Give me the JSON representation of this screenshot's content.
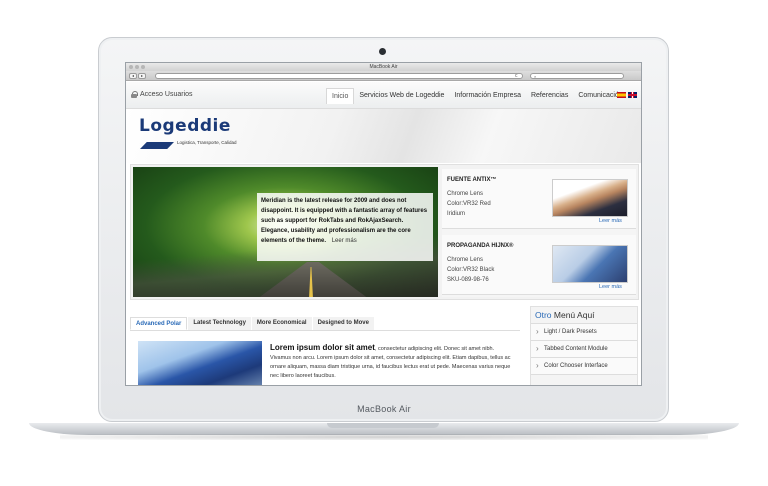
{
  "device": {
    "brand": "MacBook Air"
  },
  "browser": {
    "window_title": "MacBook Air",
    "back_glyph": "◂",
    "forward_glyph": "▸",
    "reload_glyph": "c",
    "url_placeholder": "",
    "search_placeholder": ""
  },
  "nav": {
    "user_access": "Acceso Usuarios",
    "items": [
      {
        "label": "Inicio",
        "active": true
      },
      {
        "label": "Servicios Web de Logeddie"
      },
      {
        "label": "Información Empresa"
      },
      {
        "label": "Referencias"
      },
      {
        "label": "Comunicación"
      }
    ],
    "flags": [
      "es-flag-icon",
      "uk-flag-icon"
    ]
  },
  "header": {
    "logo": "Logeddie",
    "tagline": "Logistica, Transporte, Calidad"
  },
  "slideshow": {
    "caption": "Meridian is the latest release for 2009 and does not disappoint. It is equipped with a fantastic array of features such as support for RokTabs and RokAjaxSearch. Elegance, usability and professionalism are the core elements of the theme.",
    "more": "Leer más"
  },
  "products": [
    {
      "title": "FUENTE ANTIX™",
      "lines": [
        "Chrome Lens",
        "Color:VR32 Red",
        "Iridium"
      ],
      "more": "Leer más",
      "image": "handshake-image"
    },
    {
      "title": "PROPAGANDA HIJNX®",
      "lines": [
        "Chrome Lens",
        "Color:VR32 Black",
        "SKU-089-98-76"
      ],
      "more": "Leer más",
      "image": "calculator-image"
    }
  ],
  "tabs": [
    "Advanced Polar",
    "Latest Technology",
    "More Economical",
    "Designed to Move"
  ],
  "article": {
    "title": "Lorem ipsum dolor sit amet",
    "text": ", consectetur adipiscing elit. Donec sit amet nibh. Vivamus non arcu. Lorem ipsum dolor sit amet, consectetur adipiscing elit. Etiam dapibus, tellus ac ornare aliquam, massa diam tristique urna, id faucibus lectus erat ut pede. Maecenas varius neque nec libero laoreet faucibus."
  },
  "side_menu": {
    "title_accent": "Otro",
    "title_rest": " Menú Aquí",
    "items": [
      "Light / Dark Presets",
      "Tabbed Content Module",
      "Color Chooser Interface"
    ]
  },
  "colors": {
    "brand_blue": "#1b3a78",
    "link_blue": "#2a6ab7"
  }
}
